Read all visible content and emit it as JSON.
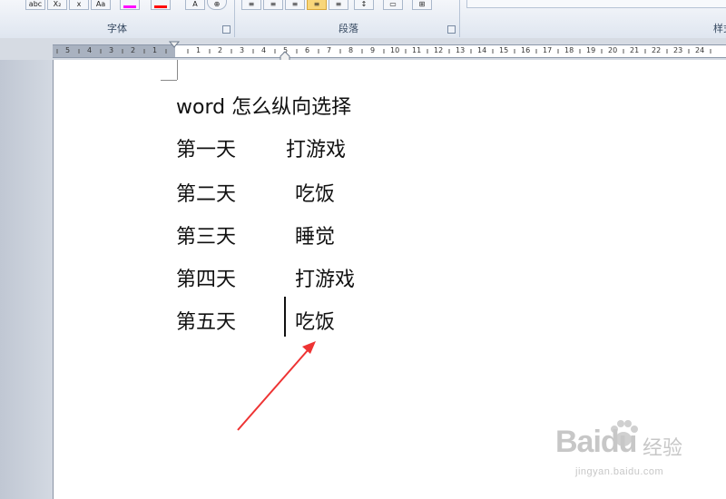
{
  "ribbon": {
    "groups": [
      {
        "label": "字体"
      },
      {
        "label": "段落"
      },
      {
        "label": "样式"
      }
    ],
    "font_buttons": [
      "abc",
      "X₂",
      "A",
      "Aa",
      "A",
      "A"
    ],
    "colors": {
      "highlight": "#ff00ff",
      "font_color": "#ff0000",
      "accent_active": "#f8d67a"
    }
  },
  "ruler": {
    "numbers": [
      "5",
      "4",
      "3",
      "2",
      "1",
      "",
      "1",
      "2",
      "3",
      "4",
      "5",
      "6",
      "7",
      "8",
      "9",
      "10",
      "11",
      "12",
      "13",
      "14",
      "15",
      "16",
      "17",
      "18",
      "19",
      "20",
      "21",
      "22",
      "23",
      "24"
    ]
  },
  "document": {
    "title": "word 怎么纵向选择",
    "rows": [
      {
        "day": "第一天",
        "activity": "打游戏"
      },
      {
        "day": "第二天",
        "activity": "吃饭"
      },
      {
        "day": "第三天",
        "activity": "睡觉"
      },
      {
        "day": "第四天",
        "activity": "打游戏"
      },
      {
        "day": "第五天",
        "activity": "吃饭"
      }
    ]
  },
  "annotation": {
    "arrow_color": "#ee3333"
  },
  "watermark": {
    "brand": "Baidu",
    "cn": "经验",
    "url": "jingyan.baidu.com"
  }
}
